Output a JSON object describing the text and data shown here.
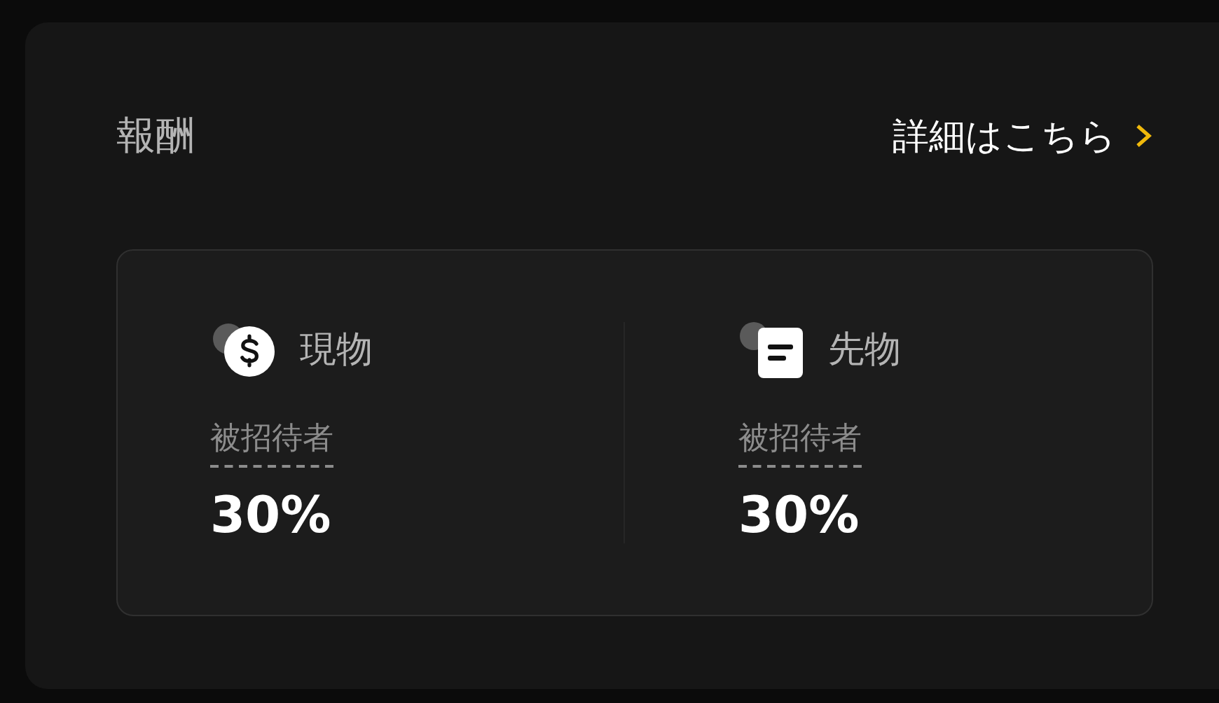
{
  "section": {
    "title": "報酬",
    "link": "詳細はこちら"
  },
  "rewards": [
    {
      "kind": "spot",
      "name": "現物",
      "label": "被招待者",
      "value": "30%"
    },
    {
      "kind": "futures",
      "name": "先物",
      "label": "被招待者",
      "value": "30%"
    }
  ]
}
